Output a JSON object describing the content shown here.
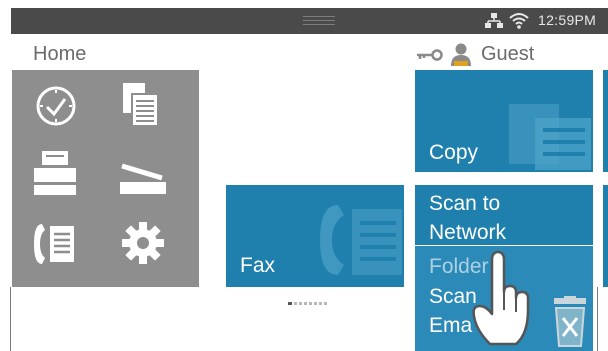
{
  "status_bar": {
    "time": "12:59PM",
    "icons": [
      "network-icon",
      "wifi-icon"
    ]
  },
  "home": {
    "title": "Home"
  },
  "user": {
    "label": "Guest",
    "icons": [
      "key-icon",
      "user-icon"
    ]
  },
  "app_panel": {
    "icons": [
      "clock-icon",
      "copy-icon",
      "fax-machine-icon",
      "scanner-icon",
      "phone-book-icon",
      "settings-gear-icon"
    ]
  },
  "tiles": {
    "fax": "Fax",
    "copy": "Copy",
    "scan_to_network": "Scan to\nNetwork",
    "scan_to_folder": "Folder",
    "scan_to_email": "Scan\nEma"
  },
  "colors": {
    "tile": "#1f7fad",
    "panel": "#8e8e8e",
    "status_bar": "#4a4a4a"
  },
  "pager": {
    "page_count": 8,
    "current_page": 1
  },
  "overlays": [
    "tap-hand-icon",
    "trash-icon"
  ]
}
